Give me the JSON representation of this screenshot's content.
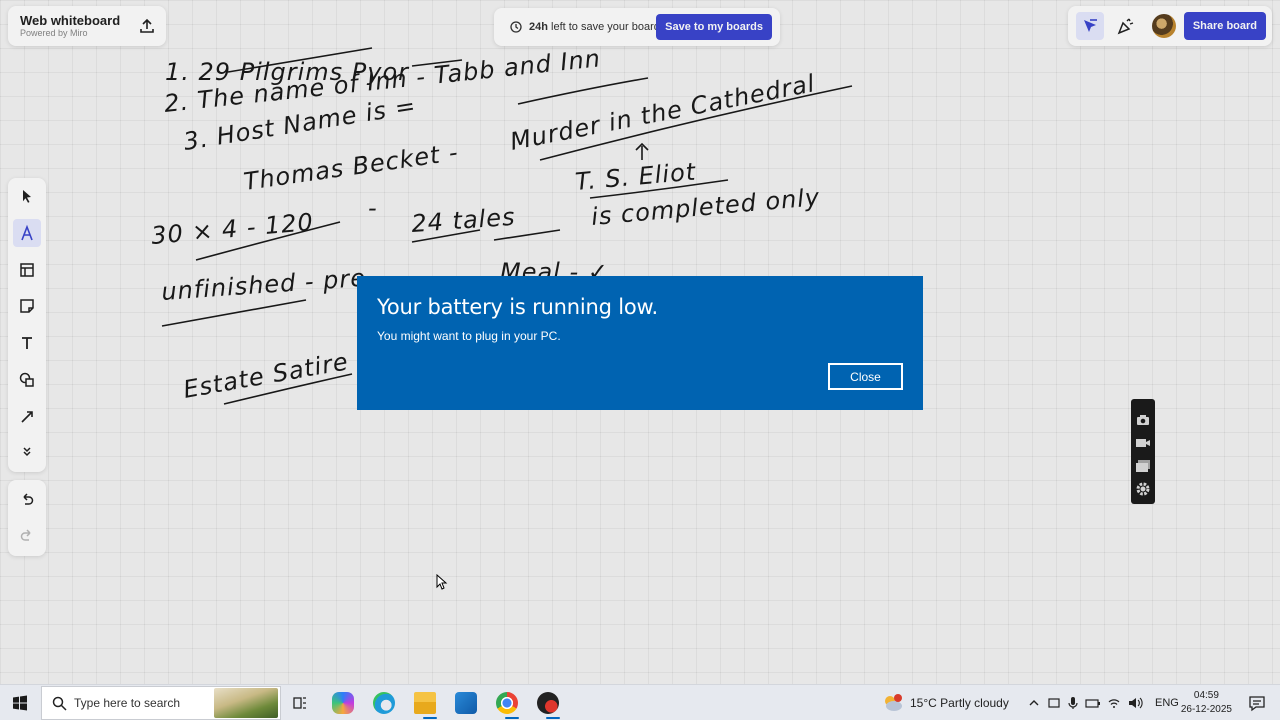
{
  "board": {
    "title": "Web whiteboard",
    "subtitle": "Powered by Miro",
    "save_notice_bold": "24h",
    "save_notice_rest": " left to save your board.",
    "save_button": "Save to my boards",
    "share_button": "Share board"
  },
  "handwriting": {
    "line1": "1.   29 Pilgrims      Pyor",
    "line2": "2.  The name of Inn  -  Tabb and Inn",
    "line3": "3.  Host Name is =",
    "line3b": "Murder in the Cathedral",
    "line4": "Thomas  Becket  -",
    "line5": "T. S. Eliot",
    "line6a": "30 × 4 - 120",
    "line6b": "-",
    "line6c": "24   tales",
    "line6d": "is  completed  only",
    "line7": "unfinished  -  pre",
    "line7b": "Meal - ✓",
    "line8": "Estate  Satire"
  },
  "toast": {
    "title": "Your battery is running low.",
    "body": "You might want to plug in your PC.",
    "close": "Close"
  },
  "taskbar": {
    "search_placeholder": "Type here to search",
    "weather": "15°C  Partly cloudy",
    "language": "ENG",
    "time": "04:59",
    "date": "26-12-2025"
  },
  "colors": {
    "accent": "#3b46d1",
    "toast_bg": "#0063b1"
  }
}
